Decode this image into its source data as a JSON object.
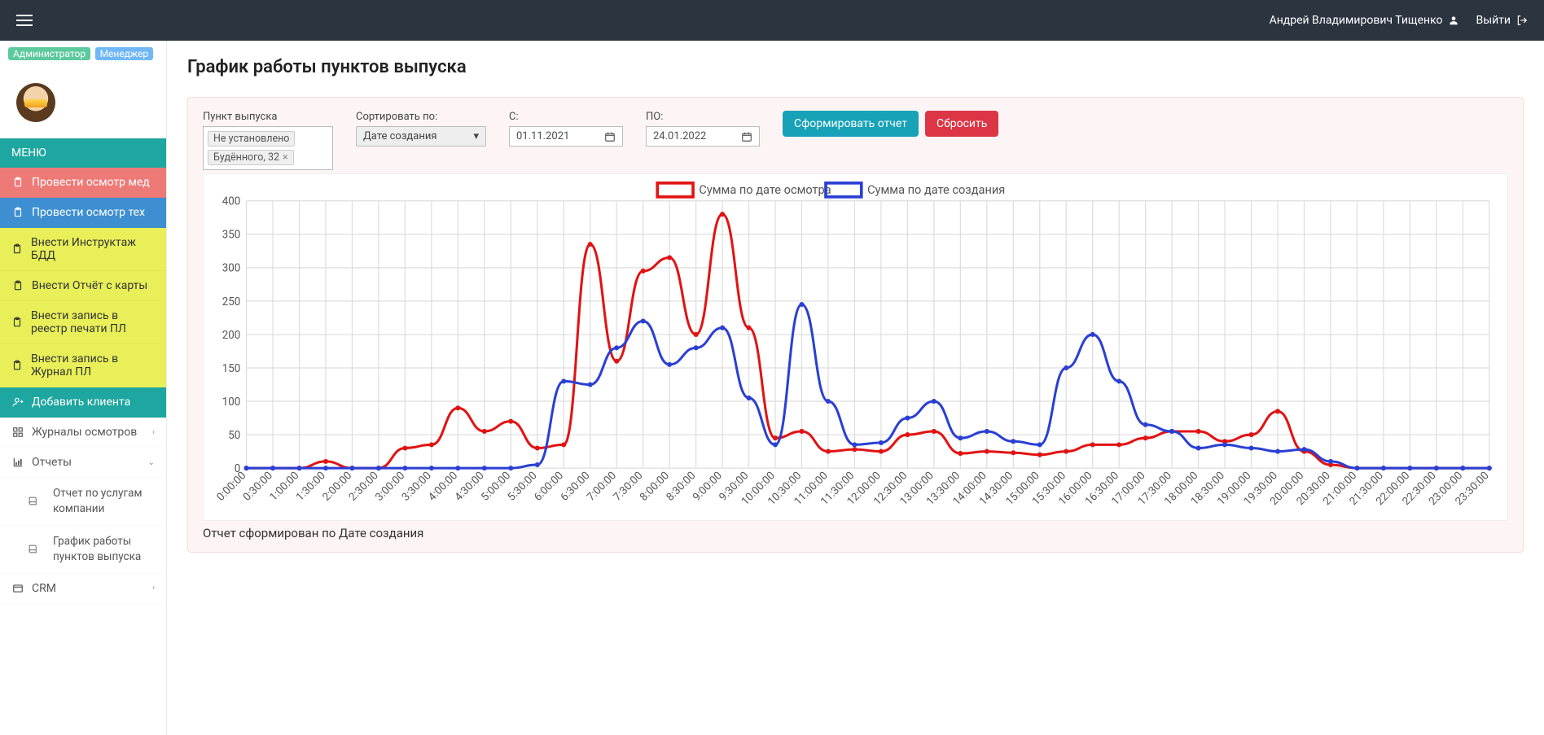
{
  "topbar": {
    "user_name": "Андрей Владимирович Тищенко",
    "logout_label": "Выйти"
  },
  "sidebar": {
    "badges": [
      "Администратор",
      "Менеджер"
    ],
    "menu_header": "МЕНЮ",
    "items": [
      {
        "label": "Провести осмотр мед",
        "cls": "red"
      },
      {
        "label": "Провести осмотр тех",
        "cls": "blue"
      },
      {
        "label": "Внести Инструктаж БДД",
        "cls": "yellow"
      },
      {
        "label": "Внести Отчёт с карты",
        "cls": "yellow"
      },
      {
        "label": "Внести запись в реестр печати ПЛ",
        "cls": "yellow"
      },
      {
        "label": "Внести запись в Журнал ПЛ",
        "cls": "yellow"
      },
      {
        "label": "Добавить клиента",
        "cls": "teal"
      },
      {
        "label": "Журналы осмотров",
        "cls": "plain",
        "chev": "‹"
      },
      {
        "label": "Отчеты",
        "cls": "plain",
        "chev": "⌄",
        "open": true
      },
      {
        "label": "CRM",
        "cls": "plain",
        "chev": "‹"
      }
    ],
    "reports_submenu": [
      "Отчет по услугам компании",
      "График работы пунктов выпуска"
    ]
  },
  "page": {
    "title": "График работы пунктов выпуска",
    "filters": {
      "point_label": "Пункт выпуска",
      "point_tokens": [
        "Не установлено",
        "Будённого, 32"
      ],
      "sort_label": "Сортировать по:",
      "sort_value": "Дате создания",
      "from_label": "С:",
      "from_value": "01.11.2021",
      "to_label": "ПО:",
      "to_value": "24.01.2022",
      "submit": "Сформировать отчет",
      "reset": "Сбросить"
    },
    "footer": "Отчет сформирован по Дате создания"
  },
  "chart_data": {
    "type": "line",
    "title": "",
    "xlabel": "",
    "ylabel": "",
    "ylim": [
      0,
      400
    ],
    "yticks": [
      0,
      50,
      100,
      150,
      200,
      250,
      300,
      350,
      400
    ],
    "x": [
      "0:00:00",
      "0:30:00",
      "1:00:00",
      "1:30:00",
      "2:00:00",
      "2:30:00",
      "3:00:00",
      "3:30:00",
      "4:00:00",
      "4:30:00",
      "5:00:00",
      "5:30:00",
      "6:00:00",
      "6:30:00",
      "7:00:00",
      "7:30:00",
      "8:00:00",
      "8:30:00",
      "9:00:00",
      "9:30:00",
      "10:00:00",
      "10:30:00",
      "11:00:00",
      "11:30:00",
      "12:00:00",
      "12:30:00",
      "13:00:00",
      "13:30:00",
      "14:00:00",
      "14:30:00",
      "15:00:00",
      "15:30:00",
      "16:00:00",
      "16:30:00",
      "17:00:00",
      "17:30:00",
      "18:00:00",
      "18:30:00",
      "19:00:00",
      "19:30:00",
      "20:00:00",
      "20:30:00",
      "21:00:00",
      "21:30:00",
      "22:00:00",
      "22:30:00",
      "23:00:00",
      "23:30:00"
    ],
    "series": [
      {
        "name": "Сумма по дате осмотра",
        "color": "#e11313",
        "cls": "red",
        "values": [
          0,
          0,
          0,
          10,
          0,
          0,
          30,
          35,
          90,
          55,
          70,
          30,
          35,
          335,
          160,
          295,
          315,
          200,
          380,
          210,
          45,
          55,
          25,
          28,
          25,
          50,
          55,
          22,
          25,
          23,
          20,
          25,
          35,
          35,
          45,
          55,
          55,
          40,
          50,
          85,
          25,
          5,
          0,
          0,
          0,
          0,
          0,
          0
        ]
      },
      {
        "name": "Сумма по дате создания",
        "color": "#2a3fd4",
        "cls": "blue",
        "values": [
          0,
          0,
          0,
          0,
          0,
          0,
          0,
          0,
          0,
          0,
          0,
          5,
          130,
          125,
          180,
          220,
          155,
          180,
          210,
          105,
          35,
          245,
          100,
          35,
          38,
          75,
          100,
          45,
          55,
          40,
          35,
          150,
          200,
          130,
          65,
          55,
          30,
          35,
          30,
          25,
          28,
          10,
          0,
          0,
          0,
          0,
          0,
          0
        ]
      }
    ],
    "legend_position": "top"
  }
}
